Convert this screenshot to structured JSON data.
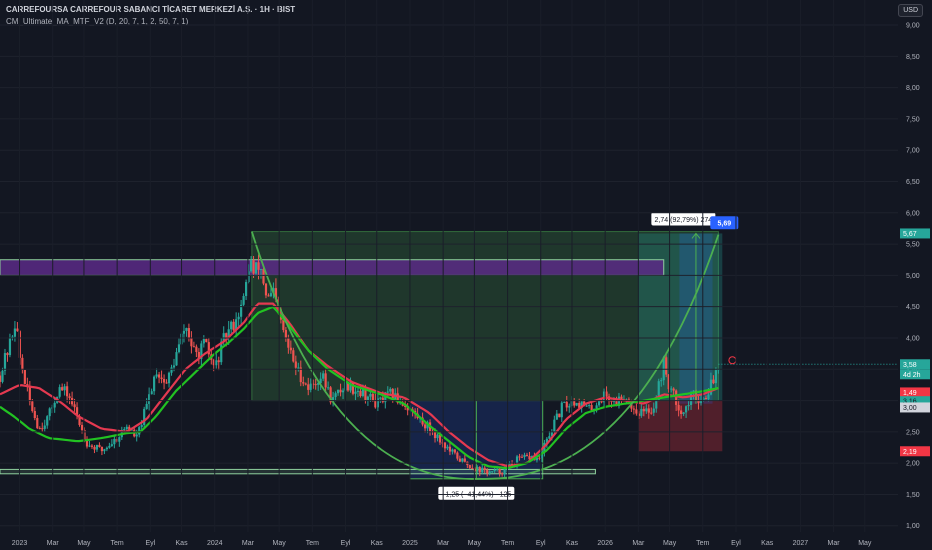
{
  "header": {
    "title": "CARREFOURSA CARREFOUR SABANCI TİCARET MERKEZİ A.Ş. · 1H · BIST",
    "indicator": "CM_Ultimate_MA_MTF_V2 (D, 20, 7, 1, 2, 50, 7, 1)",
    "currency": "USD"
  },
  "chart_data": {
    "type": "candlestick",
    "x_range": [
      2022.9,
      2027.5
    ],
    "y_range": [
      0.9,
      9.4
    ],
    "y_ticks": [
      "9,00",
      "8,50",
      "8,00",
      "7,50",
      "7,00",
      "6,50",
      "6,00",
      "5,50",
      "5,00",
      "4,50",
      "4,00",
      "3,50",
      "3,00",
      "2,50",
      "2,00",
      "1,50",
      "1,00"
    ],
    "y_tick_values": [
      9,
      8.5,
      8,
      7.5,
      7,
      6.5,
      6,
      5.5,
      5,
      4.5,
      4,
      3.5,
      3,
      2.5,
      2,
      1.5,
      1
    ],
    "x_ticks": [
      {
        "label": "2023",
        "t": 2023.0
      },
      {
        "label": "Mar",
        "t": 2023.17
      },
      {
        "label": "May",
        "t": 2023.33
      },
      {
        "label": "Tem",
        "t": 2023.5
      },
      {
        "label": "Eyl",
        "t": 2023.67
      },
      {
        "label": "Kas",
        "t": 2023.83
      },
      {
        "label": "2024",
        "t": 2024.0
      },
      {
        "label": "Mar",
        "t": 2024.17
      },
      {
        "label": "May",
        "t": 2024.33
      },
      {
        "label": "Tem",
        "t": 2024.5
      },
      {
        "label": "Eyl",
        "t": 2024.67
      },
      {
        "label": "Kas",
        "t": 2024.83
      },
      {
        "label": "2025",
        "t": 2025.0
      },
      {
        "label": "Mar",
        "t": 2025.17
      },
      {
        "label": "May",
        "t": 2025.33
      },
      {
        "label": "Tem",
        "t": 2025.5
      },
      {
        "label": "Eyl",
        "t": 2025.67
      },
      {
        "label": "Kas",
        "t": 2025.83
      },
      {
        "label": "2026",
        "t": 2026.0
      },
      {
        "label": "Mar",
        "t": 2026.17
      },
      {
        "label": "May",
        "t": 2026.33
      },
      {
        "label": "Tem",
        "t": 2026.5
      },
      {
        "label": "Eyl",
        "t": 2026.67
      },
      {
        "label": "Kas",
        "t": 2026.83
      },
      {
        "label": "2027",
        "t": 2027.0
      },
      {
        "label": "Mar",
        "t": 2027.17
      },
      {
        "label": "May",
        "t": 2027.33
      }
    ],
    "price_anchors": [
      [
        2022.9,
        3.4
      ],
      [
        2022.95,
        3.9
      ],
      [
        2022.98,
        4.3
      ],
      [
        2023.0,
        3.7
      ],
      [
        2023.05,
        3.0
      ],
      [
        2023.1,
        2.55
      ],
      [
        2023.15,
        2.75
      ],
      [
        2023.2,
        3.2
      ],
      [
        2023.25,
        3.1
      ],
      [
        2023.3,
        2.7
      ],
      [
        2023.35,
        2.3
      ],
      [
        2023.42,
        2.2
      ],
      [
        2023.5,
        2.4
      ],
      [
        2023.55,
        2.6
      ],
      [
        2023.6,
        2.4
      ],
      [
        2023.65,
        2.9
      ],
      [
        2023.7,
        3.5
      ],
      [
        2023.75,
        3.25
      ],
      [
        2023.8,
        3.7
      ],
      [
        2023.85,
        4.2
      ],
      [
        2023.9,
        3.7
      ],
      [
        2023.95,
        3.9
      ],
      [
        2024.0,
        3.5
      ],
      [
        2024.05,
        4.0
      ],
      [
        2024.1,
        4.25
      ],
      [
        2024.15,
        4.6
      ],
      [
        2024.18,
        5.3
      ],
      [
        2024.2,
        5.0
      ],
      [
        2024.23,
        5.2
      ],
      [
        2024.27,
        4.6
      ],
      [
        2024.3,
        4.7
      ],
      [
        2024.33,
        4.35
      ],
      [
        2024.37,
        3.9
      ],
      [
        2024.42,
        3.5
      ],
      [
        2024.48,
        3.2
      ],
      [
        2024.55,
        3.4
      ],
      [
        2024.6,
        3.0
      ],
      [
        2024.67,
        3.25
      ],
      [
        2024.75,
        3.15
      ],
      [
        2024.83,
        2.95
      ],
      [
        2024.9,
        3.1
      ],
      [
        2024.97,
        2.95
      ],
      [
        2025.05,
        2.7
      ],
      [
        2025.12,
        2.5
      ],
      [
        2025.2,
        2.2
      ],
      [
        2025.28,
        2.0
      ],
      [
        2025.35,
        1.9
      ],
      [
        2025.42,
        1.85
      ],
      [
        2025.48,
        1.88
      ],
      [
        2025.55,
        2.05
      ],
      [
        2025.62,
        2.1
      ],
      [
        2025.66,
        2.05
      ],
      [
        2025.72,
        2.5
      ],
      [
        2025.78,
        2.9
      ],
      [
        2025.85,
        3.0
      ],
      [
        2025.92,
        2.85
      ],
      [
        2026.0,
        3.1
      ],
      [
        2026.05,
        2.95
      ],
      [
        2026.1,
        3.1
      ],
      [
        2026.15,
        2.85
      ],
      [
        2026.2,
        2.8
      ],
      [
        2026.25,
        2.9
      ],
      [
        2026.3,
        3.6
      ],
      [
        2026.32,
        3.3
      ],
      [
        2026.36,
        3.0
      ],
      [
        2026.4,
        2.8
      ],
      [
        2026.45,
        3.1
      ],
      [
        2026.5,
        3.0
      ],
      [
        2026.55,
        3.3
      ],
      [
        2026.58,
        3.58
      ]
    ],
    "ma_green_anchors": [
      [
        2022.9,
        2.9
      ],
      [
        2022.97,
        2.75
      ],
      [
        2023.05,
        2.55
      ],
      [
        2023.15,
        2.4
      ],
      [
        2023.3,
        2.35
      ],
      [
        2023.42,
        2.4
      ],
      [
        2023.55,
        2.48
      ],
      [
        2023.62,
        2.5
      ],
      [
        2023.7,
        2.75
      ],
      [
        2023.8,
        3.15
      ],
      [
        2023.9,
        3.45
      ],
      [
        2024.0,
        3.75
      ],
      [
        2024.08,
        3.95
      ],
      [
        2024.15,
        4.15
      ],
      [
        2024.22,
        4.4
      ],
      [
        2024.3,
        4.5
      ],
      [
        2024.38,
        4.2
      ],
      [
        2024.48,
        3.8
      ],
      [
        2024.58,
        3.5
      ],
      [
        2024.7,
        3.25
      ],
      [
        2024.85,
        3.1
      ],
      [
        2024.97,
        2.95
      ],
      [
        2025.1,
        2.6
      ],
      [
        2025.2,
        2.35
      ],
      [
        2025.3,
        2.1
      ],
      [
        2025.4,
        1.95
      ],
      [
        2025.5,
        1.92
      ],
      [
        2025.6,
        2.0
      ],
      [
        2025.7,
        2.2
      ],
      [
        2025.8,
        2.55
      ],
      [
        2025.9,
        2.8
      ],
      [
        2026.0,
        2.9
      ],
      [
        2026.1,
        2.95
      ],
      [
        2026.2,
        3.0
      ],
      [
        2026.3,
        3.05
      ],
      [
        2026.4,
        3.1
      ],
      [
        2026.5,
        3.15
      ],
      [
        2026.58,
        3.2
      ]
    ],
    "ma_red_anchors": [
      [
        2022.9,
        3.1
      ],
      [
        2023.0,
        3.25
      ],
      [
        2023.1,
        3.2
      ],
      [
        2023.2,
        3.0
      ],
      [
        2023.3,
        2.75
      ],
      [
        2023.42,
        2.55
      ],
      [
        2023.55,
        2.5
      ],
      [
        2023.65,
        2.7
      ],
      [
        2023.75,
        3.1
      ],
      [
        2023.85,
        3.5
      ],
      [
        2023.95,
        3.75
      ],
      [
        2024.05,
        3.95
      ],
      [
        2024.15,
        4.25
      ],
      [
        2024.22,
        4.55
      ],
      [
        2024.3,
        4.55
      ],
      [
        2024.38,
        4.25
      ],
      [
        2024.48,
        3.8
      ],
      [
        2024.58,
        3.55
      ],
      [
        2024.7,
        3.3
      ],
      [
        2024.85,
        3.12
      ],
      [
        2024.97,
        3.05
      ],
      [
        2025.1,
        2.8
      ],
      [
        2025.2,
        2.5
      ],
      [
        2025.3,
        2.25
      ],
      [
        2025.4,
        2.05
      ],
      [
        2025.5,
        1.95
      ],
      [
        2025.6,
        2.0
      ],
      [
        2025.7,
        2.3
      ],
      [
        2025.8,
        2.7
      ],
      [
        2025.9,
        2.95
      ],
      [
        2026.0,
        3.05
      ],
      [
        2026.1,
        3.0
      ],
      [
        2026.2,
        2.95
      ],
      [
        2026.3,
        3.1
      ],
      [
        2026.4,
        3.05
      ],
      [
        2026.5,
        3.1
      ],
      [
        2026.58,
        3.2
      ]
    ],
    "cup_arc": {
      "start": [
        2024.19,
        5.7
      ],
      "bottom": [
        2025.35,
        1.75
      ],
      "end": [
        2026.58,
        5.65
      ]
    },
    "zones": [
      {
        "kind": "resistance",
        "t0": 2022.9,
        "t1": 2026.3,
        "y0": 5.0,
        "y1": 5.25,
        "color": "#5b2a86"
      },
      {
        "kind": "support",
        "t0": 2022.9,
        "t1": 2025.95,
        "y0": 1.83,
        "y1": 1.9,
        "color": "#8fd19e"
      }
    ],
    "measure_down": {
      "t0": 2025.0,
      "t1": 2025.68,
      "y_top": 3.0,
      "y_bot": 1.75,
      "label": "−1,25 (−41,44%) −125"
    },
    "measure_up": {
      "t0": 2026.38,
      "t1": 2026.55,
      "y_top": 5.67,
      "y_bot": 2.95,
      "label": "2,74 (92,79%) 274"
    },
    "pattern_box": {
      "t0": 2024.19,
      "t1": 2026.58,
      "y_top": 5.7,
      "y_bot": 3.0
    },
    "position": {
      "t0": 2026.17,
      "t1": 2026.6,
      "entry": 3.0,
      "target": 5.67,
      "stop": 2.19
    },
    "price_badges": [
      {
        "value": 5.67,
        "label": "5,67",
        "color": "#26a69a",
        "text": "#ffffff"
      },
      {
        "value": 3.58,
        "label": "3,58",
        "color": "#26a69a",
        "text": "#ffffff"
      },
      {
        "value": 3.42,
        "label": "4d 2h",
        "color": "#26a69a",
        "text": "#ffffff"
      },
      {
        "value": 3.13,
        "label": "1,49",
        "color": "#f23645",
        "text": "#ffffff"
      },
      {
        "value": 2.99,
        "label": "3,16",
        "color": "#26a69a",
        "text": "#131722"
      },
      {
        "value": 2.89,
        "label": "3,00",
        "color": "#d1d4dc",
        "text": "#131722"
      },
      {
        "value": 2.19,
        "label": "2,19",
        "color": "#f23645",
        "text": "#ffffff"
      }
    ],
    "target_callout": {
      "value": 5.69,
      "label": "5,69"
    },
    "last_price": 3.58
  }
}
